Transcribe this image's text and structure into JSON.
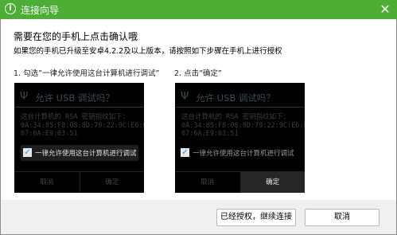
{
  "window": {
    "title": "连接向导",
    "close_glyph": "✕"
  },
  "heading": "需要在您的手机上点击确认哦",
  "subline": "如果您的手机已升级至安卓4.2.2及以上版本，请按照如下步骤在手机上进行授权",
  "steps": [
    {
      "label": "1. 勾选”一律允许使用这台计算机进行调试”",
      "phone": {
        "title": "允许 USB 调试吗？",
        "message": [
          "这台计算机的 RSA 密钥指纹如下：",
          "0A:34:85:F8:08:8D:79:22:9C:E6:0B:",
          "07:6A:E9:03:51"
        ],
        "checkbox_label": "一律允许使用这台计算机进行调试",
        "cancel": "取消",
        "ok": "确定"
      }
    },
    {
      "label": "2. 点击”确定”",
      "phone": {
        "title": "允许 USB 调试吗？",
        "message": [
          "这台计算机的 RSA 密钥指纹如下：",
          "0A:34:85:F8:08:8D:79:22:9C:E6:0B:",
          "07:6A:E9:03:51"
        ],
        "checkbox_label": "一律允许使用这台计算机进行调试",
        "cancel": "取消",
        "ok": "确定"
      }
    }
  ],
  "buttons": {
    "authorized": "已经授权，继续连接",
    "cancel": "取消"
  },
  "colors": {
    "titlebar": "#4cae34",
    "check_accent": "#2a8fd8"
  }
}
